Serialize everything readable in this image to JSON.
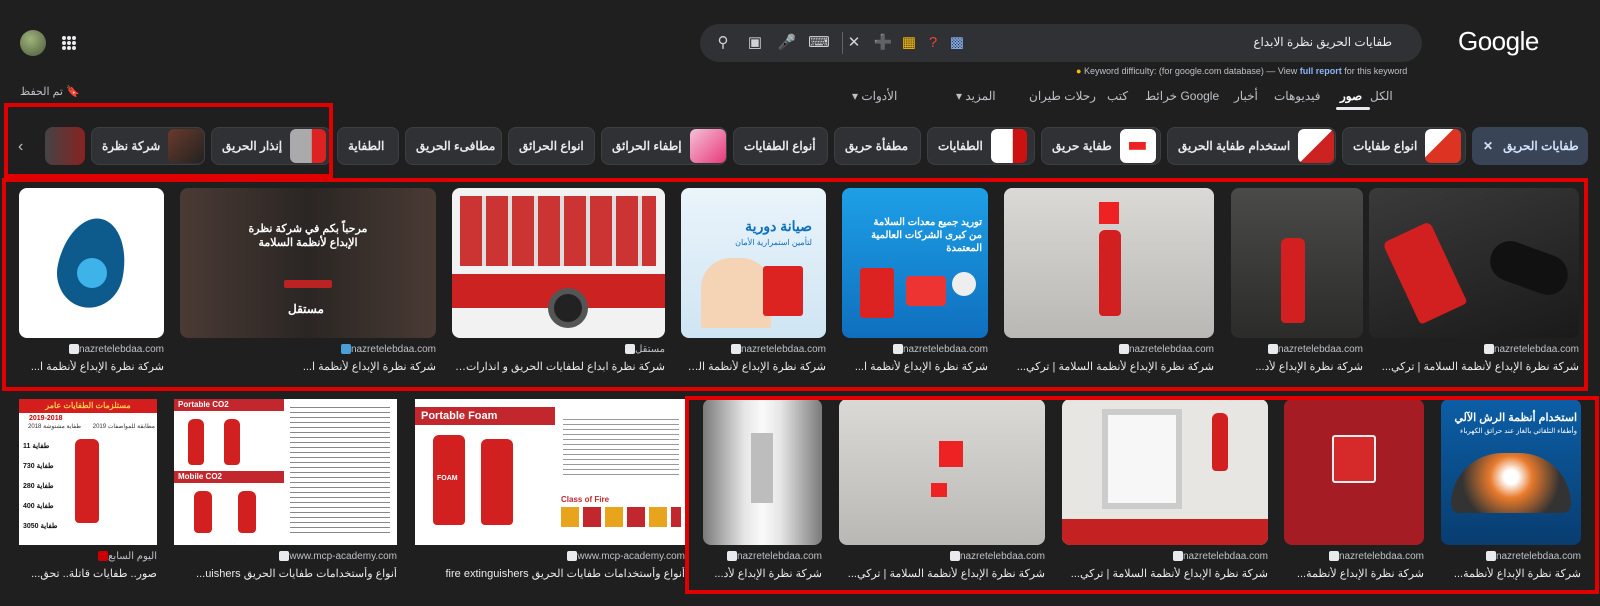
{
  "header": {
    "logo": "Google",
    "query": "طفايات الحريق نظرة الابداع",
    "saved": "تم الحفظ",
    "kd_label": "Keyword difficulty:",
    "kd_note": "(for google.com database) — View",
    "kd_link": "full report",
    "kd_tail": "for this keyword"
  },
  "icons": [
    "search-icon",
    "lens-icon",
    "mic-icon",
    "keyboard-icon",
    "clear-icon",
    "apps-icon",
    "bookmark-icon"
  ],
  "tabs": [
    "الكل",
    "صور",
    "فيديوهات",
    "أخبار",
    "خرائط Google",
    "كتب",
    "رحلات طيران",
    "المزيد",
    "الأدوات"
  ],
  "chips": [
    "طفايات الحريق",
    "انواع طفايات",
    "استخدام طفاية الحريق",
    "طفاية حريق",
    "الطفايات",
    "مطفأة حريق",
    "أنواع الطفايات",
    "إطفاء الحرائق",
    "انواع الحرائق",
    "مطافىء الحريق",
    "الطفاية",
    "إنذار الحريق",
    "شركة نظرة"
  ],
  "row1": [
    {
      "source": "nazretelebdaa.com",
      "title": "شركة نظرة الإبداع لأنظمة السلامة | تركي..."
    },
    {
      "source": "nazretelebdaa.com",
      "title": "شركة نظرة الإبداع لأد..."
    },
    {
      "source": "nazretelebdaa.com",
      "title": "شركة نظرة الإبداع لأنظمة السلامة | تركي..."
    },
    {
      "source": "nazretelebdaa.com",
      "title": "شركة نظرة الإبداع لأنظمة ا..."
    },
    {
      "source": "nazretelebdaa.com",
      "title": "شركة نظرة الإبداع لأنظمة السلامة | تركي..."
    },
    {
      "source": "مستقل",
      "title": "شركة نظرة ابداع لطفايات الحريق و انذارات و انظمة..."
    },
    {
      "source": "nazretelebdaa.com",
      "title": "شركة نظرة الإبداع لأنظمة ا..."
    }
  ],
  "row2": [
    {
      "source": "nazretelebdaa.com",
      "title": "شركة نظرة الإبداع لأنظمة..."
    },
    {
      "source": "nazretelebdaa.com",
      "title": "شركة نظرة الإبداع لأنظمة..."
    },
    {
      "source": "nazretelebdaa.com",
      "title": "شركة نظرة الإبداع لأنظمة السلامة | تركي..."
    },
    {
      "source": "nazretelebdaa.com",
      "title": "شركة نظرة الإبداع لأنظمة السلامة | تركي..."
    },
    {
      "source": "nazretelebdaa.com",
      "title": "شركة نظرة الإبداع لأد..."
    },
    {
      "source": "www.mcp-academy.com",
      "title": "أنواع وأستخدامات طفايات الحريق fire extinguishers"
    },
    {
      "source": "www.mcp-academy.com",
      "title": "أنواع وأستخدامات طفايات الحريق uishers..."
    },
    {
      "source": "اليوم السابع",
      "title": "صور.. طفايات قاتلة.. تحق..."
    }
  ],
  "image_text": {
    "r1_3": "توريد جميع معدات السلامة من كبرى الشركات العالمية المعتمدة",
    "r1_4": "صيانة دورية",
    "r1_4b": "لتأمين استمرارية الأمان",
    "r1_6": "مرحباً بكم في شركة نظرة الإبداع لأنظمة السلامة",
    "r1_6b": "مستقل",
    "r2_1": "استخدام أنظمة الرش الآلي",
    "r2_1b": "وأطفاء التلقائي بالغاز عند حرائق الكهرباء",
    "r2_6": "Portable Foam",
    "r2_6b": "FOAM",
    "r2_6c": "Class of Fire",
    "r2_7": "Portable CO2",
    "r2_7b": "Mobile CO2",
    "r2_8": "مستلزمات الطفايات عامر",
    "r2_8b": "2019-2018",
    "r2_8c": "طفاية مشتوشة 2018",
    "r2_8d": "مطابقة للمواصفات 2019",
    "r2_8e": [
      "11 طفاية",
      "730 طفاية",
      "280 طفاية",
      "400 طفاية",
      "3050 طفاية"
    ]
  }
}
